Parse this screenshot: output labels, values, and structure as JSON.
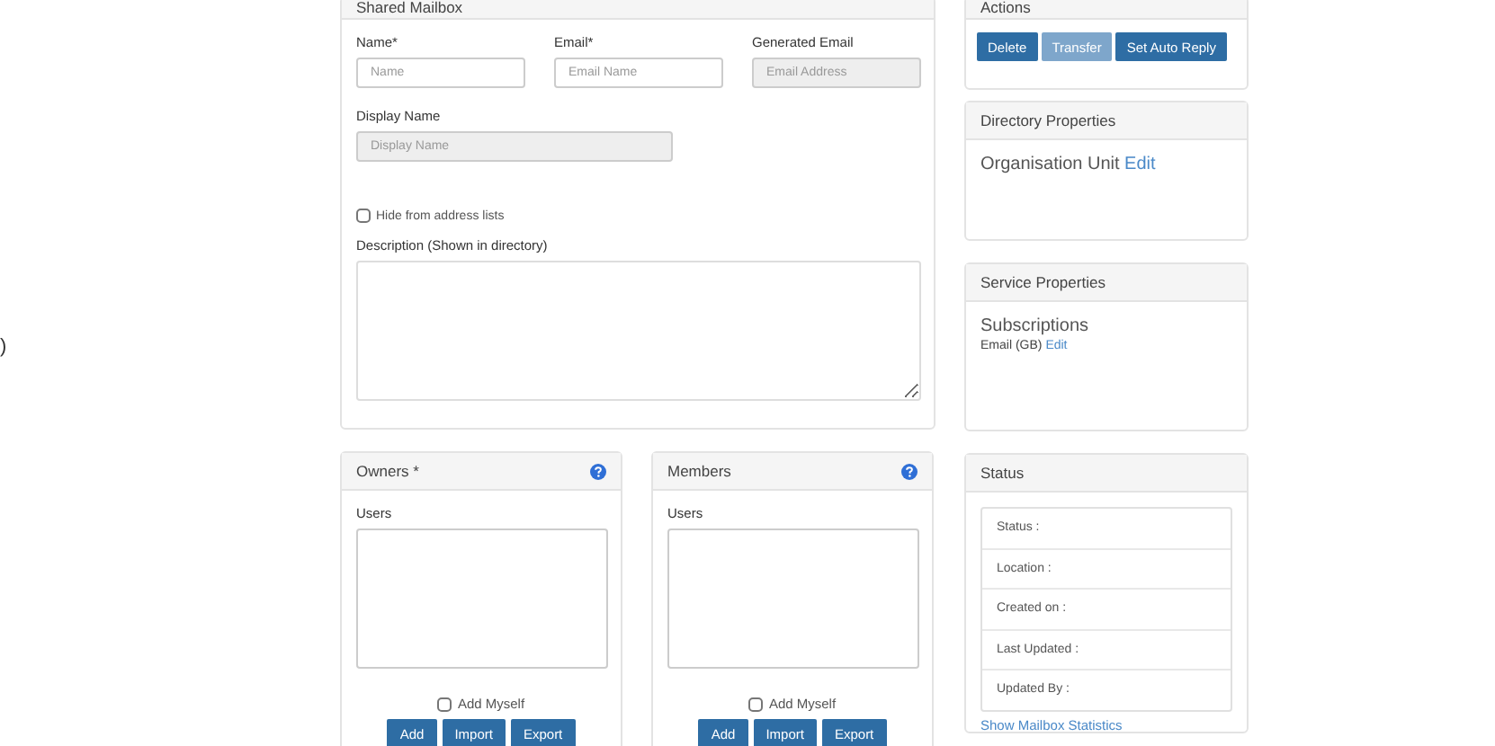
{
  "left_fragment": ")",
  "mailbox_panel": {
    "title": "Shared Mailbox",
    "fields": [
      {
        "label": "Name*",
        "placeholder": "Name",
        "disabled": false
      },
      {
        "label": "Email*",
        "placeholder": "Email Name",
        "disabled": false
      },
      {
        "label": "Generated Email",
        "placeholder": "Email Address",
        "disabled": true
      }
    ],
    "display_name": {
      "label": "Display Name",
      "placeholder": "Display Name",
      "disabled": true
    },
    "hide_from_lists": {
      "label": "Hide from address lists",
      "checked": false
    },
    "description": {
      "label": "Description (Shown in directory)"
    }
  },
  "user_panels": [
    {
      "title": "Owners *",
      "users_label": "Users",
      "add_myself": {
        "label": "Add Myself",
        "checked": false
      },
      "buttons": [
        "Add",
        "Import",
        "Export"
      ]
    },
    {
      "title": "Members",
      "users_label": "Users",
      "add_myself": {
        "label": "Add Myself",
        "checked": false
      },
      "buttons": [
        "Add",
        "Import",
        "Export"
      ]
    }
  ],
  "actions_panel": {
    "title": "Actions",
    "buttons": [
      {
        "label": "Delete",
        "disabled": false
      },
      {
        "label": "Transfer",
        "disabled": true
      },
      {
        "label": "Set Auto Reply",
        "disabled": false
      }
    ]
  },
  "directory_panel": {
    "title": "Directory Properties",
    "text": "Organisation Unit",
    "link": "Edit"
  },
  "service_panel": {
    "title": "Service Properties",
    "heading": "Subscriptions",
    "text": "Email (GB)",
    "link": "Edit"
  },
  "status_panel": {
    "title": "Status",
    "rows": [
      "Status :",
      "Location :",
      "Created on :",
      "Last Updated :",
      "Updated By :"
    ],
    "link": "Show Mailbox Statistics"
  }
}
